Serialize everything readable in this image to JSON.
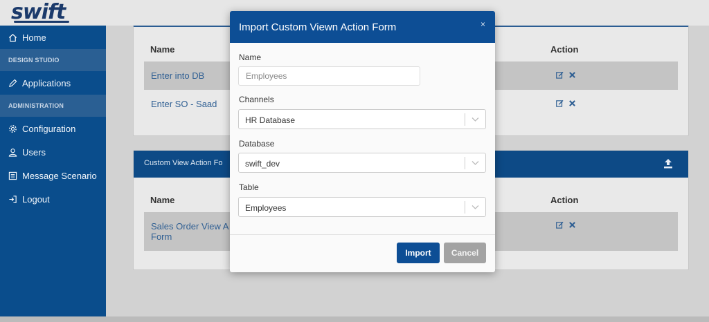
{
  "app": {
    "logo": "swift"
  },
  "sidebar": {
    "items": [
      {
        "type": "item",
        "label": "Home",
        "icon": "home-icon"
      },
      {
        "type": "section",
        "label": "DESIGN STUDIO"
      },
      {
        "type": "item",
        "label": "Applications",
        "icon": "pencil-icon"
      },
      {
        "type": "section",
        "label": "ADMINISTRATION"
      },
      {
        "type": "item",
        "label": "Configuration",
        "icon": "gear-icon"
      },
      {
        "type": "item",
        "label": "Users",
        "icon": "user-icon"
      },
      {
        "type": "item",
        "label": "Message Scenario",
        "icon": "list-icon"
      },
      {
        "type": "item",
        "label": "Logout",
        "icon": "logout-icon"
      }
    ]
  },
  "card1": {
    "headers": {
      "name": "Name",
      "action": "Action"
    },
    "rows": [
      {
        "name": "Enter into DB"
      },
      {
        "name": "Enter SO - Saad"
      }
    ]
  },
  "card2": {
    "title": "Custom View Action Fo",
    "headers": {
      "name": "Name",
      "action": "Action"
    },
    "rows": [
      {
        "name": "Sales Order View A",
        "name_line2": "Form"
      }
    ]
  },
  "modal": {
    "title": "Import Custom Viewn Action Form",
    "close": "×",
    "name_label": "Name",
    "name_placeholder": "Employees",
    "channels_label": "Channels",
    "channels_value": "HR Database",
    "database_label": "Database",
    "database_value": "swift_dev",
    "table_label": "Table",
    "table_value": "Employees",
    "import_label": "Import",
    "cancel_label": "Cancel"
  },
  "colors": {
    "primary": "#0d4e95",
    "sidebar": "#0a4d8c",
    "link": "#2f5f93",
    "cancel": "#a3a3a3"
  }
}
